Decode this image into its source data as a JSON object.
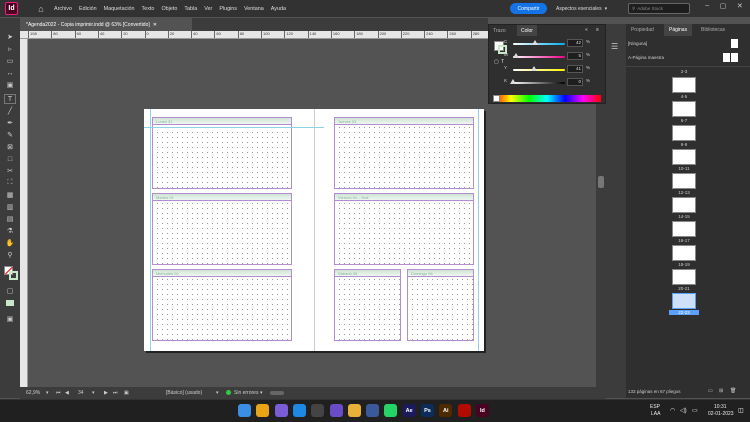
{
  "app": {
    "logo": "Id",
    "home_icon": "home-icon",
    "brand_color": "#ed1e79"
  },
  "menu": [
    "Archivo",
    "Edición",
    "Maquetación",
    "Texto",
    "Objeto",
    "Tabla",
    "Ver",
    "Plugins",
    "Ventana",
    "Ayuda"
  ],
  "header": {
    "share": "Compartir",
    "workspace": "Aspectos esenciales",
    "search_placeholder": "Adobe Stock",
    "accent": "#1473e6"
  },
  "document": {
    "tab_title": "*Agenda2022 - Copia imprimir.indd @ 63% [Convertido]"
  },
  "ruler": {
    "ticks": [
      "108",
      "80",
      "60",
      "40",
      "20",
      "0",
      "20",
      "40",
      "60",
      "80",
      "100",
      "120",
      "140",
      "160",
      "180",
      "200",
      "220",
      "240",
      "260",
      "280"
    ]
  },
  "spread": {
    "left_page": [
      {
        "label": "Lunes 31"
      },
      {
        "label": "Martes 01"
      },
      {
        "label": "Miércoles 02"
      }
    ],
    "right_page": [
      {
        "label": "Jueves 03"
      },
      {
        "label": "Viernes 04 – Hoil"
      },
      {
        "label": "Sábado 05"
      },
      {
        "label": "Domingo 06"
      }
    ]
  },
  "status": {
    "zoom": "62,9%",
    "page": "34",
    "style": "[Básico] (usado)",
    "errors": "Sin errores"
  },
  "color_panel": {
    "tabs": [
      "Trazo",
      "Color"
    ],
    "sliders": [
      {
        "label": "C",
        "value": "42",
        "fraction": 0.42,
        "gradient": "linear-gradient(90deg,#fff,#00aeef)"
      },
      {
        "label": "M",
        "value": "5",
        "fraction": 0.05,
        "gradient": "linear-gradient(90deg,#fff,#ec008c)"
      },
      {
        "label": "Y",
        "value": "41",
        "fraction": 0.41,
        "gradient": "linear-gradient(90deg,#fff,#fff200)"
      },
      {
        "label": "K",
        "value": "0",
        "fraction": 0.0,
        "gradient": "linear-gradient(90deg,#fff,#000)"
      }
    ],
    "pct": "%"
  },
  "pages_panel": {
    "tabs": [
      "Propiedad",
      "Páginas",
      "Bibliotecas"
    ],
    "none_master": "[Ninguna]",
    "master": "A-Página maestra",
    "thumbs": [
      "4-5",
      "6-7",
      "8-9",
      "10-11",
      "12-13",
      "14-15",
      "16-17",
      "18-19",
      "20-21",
      "22-23"
    ],
    "top_label": "2-3",
    "selected": "22-23",
    "footer": "133 páginas en 67 pliegos"
  },
  "taskbar": {
    "lang1": "ESP",
    "lang2": "LAA",
    "time": "10:31",
    "date": "02-01-2023",
    "apps": [
      {
        "name": "windows-start-icon",
        "label": "",
        "color": "#3a8ee6"
      },
      {
        "name": "chrome-icon",
        "label": "",
        "color": "#e8a317"
      },
      {
        "name": "copilot-icon",
        "label": "",
        "color": "#7a5cd6"
      },
      {
        "name": "edge-icon",
        "label": "",
        "color": "#1e88e5"
      },
      {
        "name": "explorer-icon",
        "label": "",
        "color": "#444"
      },
      {
        "name": "media-icon",
        "label": "",
        "color": "#6a4cc9"
      },
      {
        "name": "folder-icon",
        "label": "",
        "color": "#e8b23a"
      },
      {
        "name": "store-icon",
        "label": "",
        "color": "#3b5998"
      },
      {
        "name": "whatsapp-icon",
        "label": "",
        "color": "#25d366"
      },
      {
        "name": "after-effects-icon",
        "label": "Ae",
        "color": "#1a1a5c"
      },
      {
        "name": "photoshop-icon",
        "label": "Ps",
        "color": "#0c2d5c"
      },
      {
        "name": "illustrator-icon",
        "label": "Ai",
        "color": "#4d2a00"
      },
      {
        "name": "acrobat-icon",
        "label": "",
        "color": "#b30b00"
      },
      {
        "name": "indesign-icon",
        "label": "Id",
        "color": "#49021f"
      }
    ]
  }
}
